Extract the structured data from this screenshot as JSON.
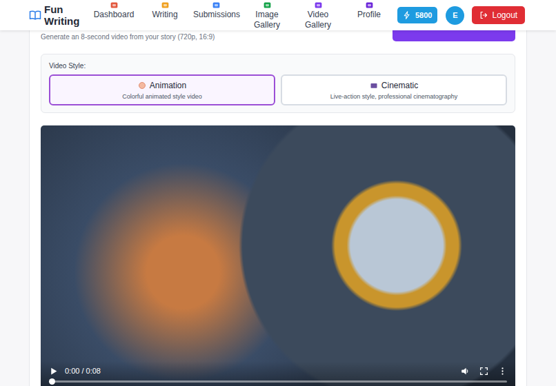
{
  "app": {
    "logo": "Fun Writing"
  },
  "nav": [
    {
      "label": "Dashboard",
      "selected": false
    },
    {
      "label": "Writing",
      "selected": false
    },
    {
      "label": "Submissions",
      "selected": false
    },
    {
      "label": "Image Gallery",
      "selected": false
    },
    {
      "label": "Video Gallery",
      "selected": false
    },
    {
      "label": "Profile",
      "selected": false
    }
  ],
  "credits": "5800",
  "avatar": "E",
  "logout": "Logout",
  "subtitle": "Generate an 8-second video from your story (720p, 16:9)",
  "video_style": {
    "label": "Video Style:",
    "options": [
      {
        "title": "Animation",
        "description": "Colorful animated style video",
        "selected": true
      },
      {
        "title": "Cinematic",
        "description": "Live-action style, professional cinematography",
        "selected": false
      }
    ]
  },
  "player": {
    "time": "0:00 / 0:08",
    "level": 0
  }
}
